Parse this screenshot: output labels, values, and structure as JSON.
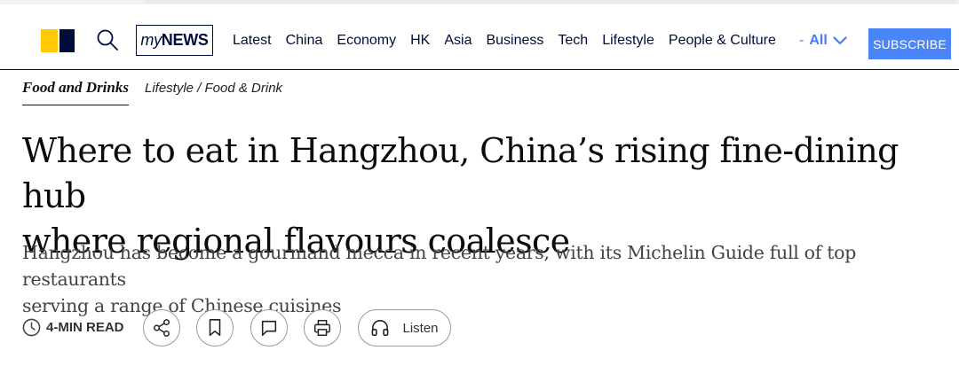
{
  "header": {
    "brand_logo_label": "SCMP",
    "mynews": {
      "my": "my",
      "news": "NEWS"
    },
    "nav": [
      "Latest",
      "China",
      "Economy",
      "HK",
      "Asia",
      "Business",
      "Tech",
      "Lifestyle",
      "People & Culture"
    ],
    "all_prefix": "-",
    "all_label": "All",
    "subscribe_label": "SUBSCRIBE"
  },
  "breadcrumb": {
    "section": "Food and Drinks",
    "path": "Lifestyle / Food & Drink"
  },
  "article": {
    "headline_line1": "Where to eat in Hangzhou, China’s rising fine-dining hub",
    "headline_line2": "where regional flavours coalesce",
    "summary_line1": "Hangzhou has become a gourmand mecca in recent years, with its Michelin Guide full of top restaurants",
    "summary_line2": "serving a range of Chinese cuisines"
  },
  "toolbar": {
    "read_time": "4-MIN READ",
    "listen_label": "Listen"
  },
  "colors": {
    "brand_yellow": "#ffca05",
    "brand_navy": "#000d3b",
    "accent_blue": "#4a86f7"
  },
  "icons": [
    "search-icon",
    "clock-icon",
    "share-icon",
    "bookmark-icon",
    "comment-icon",
    "print-icon",
    "headphones-icon",
    "chevron-down-icon"
  ]
}
